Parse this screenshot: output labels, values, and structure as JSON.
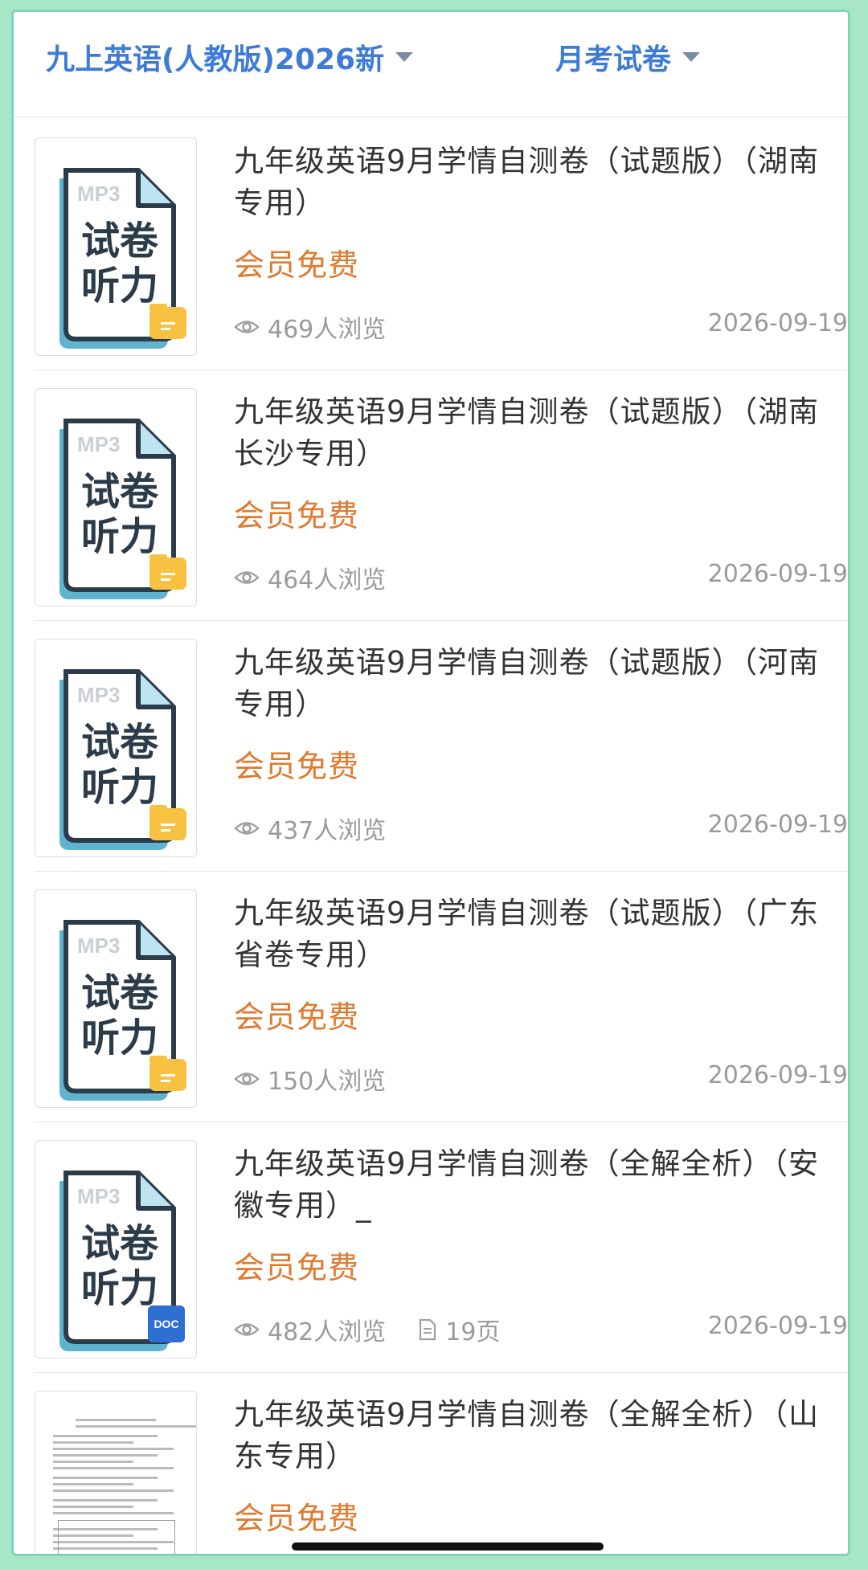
{
  "header": {
    "textbook": "九上英语(人教版)2026新",
    "category": "月考试卷"
  },
  "items": [
    {
      "title": "九年级英语9月学情自测卷（试题版）（湖南专用）",
      "price": "会员免费",
      "views": "469人浏览",
      "date": "2026-09-19",
      "thumb_mp3": "MP3",
      "thumb_line1": "试卷",
      "thumb_line2": "听力",
      "badge": "folder"
    },
    {
      "title": "九年级英语9月学情自测卷（试题版）（湖南长沙专用）",
      "price": "会员免费",
      "views": "464人浏览",
      "date": "2026-09-19",
      "thumb_mp3": "MP3",
      "thumb_line1": "试卷",
      "thumb_line2": "听力",
      "badge": "folder"
    },
    {
      "title": "九年级英语9月学情自测卷（试题版）（河南专用）",
      "price": "会员免费",
      "views": "437人浏览",
      "date": "2026-09-19",
      "thumb_mp3": "MP3",
      "thumb_line1": "试卷",
      "thumb_line2": "听力",
      "badge": "folder"
    },
    {
      "title": "九年级英语9月学情自测卷（试题版）（广东省卷专用）",
      "price": "会员免费",
      "views": "150人浏览",
      "date": "2026-09-19",
      "thumb_mp3": "MP3",
      "thumb_line1": "试卷",
      "thumb_line2": "听力",
      "badge": "folder"
    },
    {
      "title": "九年级英语9月学情自测卷（全解全析）（安徽专用）_",
      "price": "会员免费",
      "views": "482人浏览",
      "pages": "19页",
      "date": "2026-09-19",
      "thumb_mp3": "MP3",
      "thumb_line1": "试卷",
      "thumb_line2": "听力",
      "badge": "DOC"
    },
    {
      "title": "九年级英语9月学情自测卷（全解全析）（山东专用）",
      "price": "会员免费",
      "thumb_type": "document-preview"
    }
  ]
}
